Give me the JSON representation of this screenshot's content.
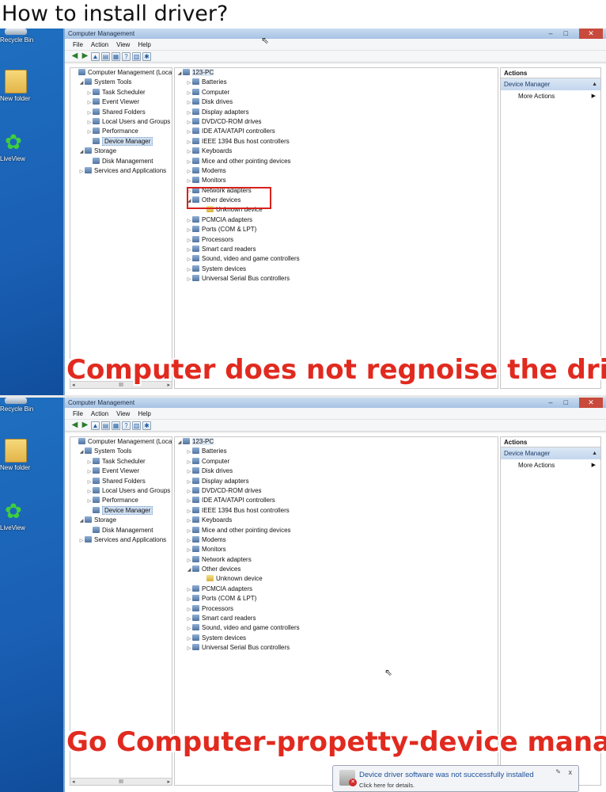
{
  "heading": "How to install driver?",
  "desktop": {
    "icons": [
      {
        "label": "Recycle Bin",
        "icon": "recycle-bin-icon"
      },
      {
        "label": "New folder",
        "icon": "folder-icon"
      },
      {
        "label": "LiveView",
        "icon": "liveview-icon"
      }
    ]
  },
  "window": {
    "title": "Computer Management",
    "menu": [
      "File",
      "Action",
      "View",
      "Help"
    ],
    "left_tree": [
      {
        "label": "Computer Management (Local",
        "level": 0,
        "exp": "",
        "icon": "computer-management-icon"
      },
      {
        "label": "System Tools",
        "level": 1,
        "exp": "◢",
        "icon": "tools-icon"
      },
      {
        "label": "Task Scheduler",
        "level": 2,
        "exp": "▷",
        "icon": "clock-icon"
      },
      {
        "label": "Event Viewer",
        "level": 2,
        "exp": "▷",
        "icon": "event-viewer-icon"
      },
      {
        "label": "Shared Folders",
        "level": 2,
        "exp": "▷",
        "icon": "shared-folder-icon"
      },
      {
        "label": "Local Users and Groups",
        "level": 2,
        "exp": "▷",
        "icon": "users-icon"
      },
      {
        "label": "Performance",
        "level": 2,
        "exp": "▷",
        "icon": "performance-icon"
      },
      {
        "label": "Device Manager",
        "level": 2,
        "exp": "",
        "icon": "device-manager-icon",
        "selected": true
      },
      {
        "label": "Storage",
        "level": 1,
        "exp": "◢",
        "icon": "storage-icon"
      },
      {
        "label": "Disk Management",
        "level": 2,
        "exp": "",
        "icon": "disk-management-icon"
      },
      {
        "label": "Services and Applications",
        "level": 1,
        "exp": "▷",
        "icon": "services-icon"
      }
    ],
    "scroll_mid": "III",
    "device_root": "123-PC",
    "devices": [
      {
        "label": "Batteries",
        "level": 1,
        "exp": "▷",
        "icon": "battery-icon"
      },
      {
        "label": "Computer",
        "level": 1,
        "exp": "▷",
        "icon": "computer-icon"
      },
      {
        "label": "Disk drives",
        "level": 1,
        "exp": "▷",
        "icon": "disk-drive-icon"
      },
      {
        "label": "Display adapters",
        "level": 1,
        "exp": "▷",
        "icon": "display-adapter-icon"
      },
      {
        "label": "DVD/CD-ROM drives",
        "level": 1,
        "exp": "▷",
        "icon": "dvd-icon"
      },
      {
        "label": "IDE ATA/ATAPI controllers",
        "level": 1,
        "exp": "▷",
        "icon": "ide-controller-icon"
      },
      {
        "label": "IEEE 1394 Bus host controllers",
        "level": 1,
        "exp": "▷",
        "icon": "ieee1394-icon"
      },
      {
        "label": "Keyboards",
        "level": 1,
        "exp": "▷",
        "icon": "keyboard-icon"
      },
      {
        "label": "Mice and other pointing devices",
        "level": 1,
        "exp": "▷",
        "icon": "mouse-icon"
      },
      {
        "label": "Modems",
        "level": 1,
        "exp": "▷",
        "icon": "modem-icon"
      },
      {
        "label": "Monitors",
        "level": 1,
        "exp": "▷",
        "icon": "monitor-icon"
      },
      {
        "label": "Network adapters",
        "level": 1,
        "exp": "▷",
        "icon": "network-adapter-icon"
      },
      {
        "label": "Other devices",
        "level": 1,
        "exp": "◢",
        "icon": "other-devices-icon"
      },
      {
        "label": "Unknown device",
        "level": 2,
        "exp": "",
        "icon": "warning-device-icon"
      },
      {
        "label": "PCMCIA adapters",
        "level": 1,
        "exp": "▷",
        "icon": "pcmcia-icon"
      },
      {
        "label": "Ports (COM & LPT)",
        "level": 1,
        "exp": "▷",
        "icon": "port-icon"
      },
      {
        "label": "Processors",
        "level": 1,
        "exp": "▷",
        "icon": "processor-icon"
      },
      {
        "label": "Smart card readers",
        "level": 1,
        "exp": "▷",
        "icon": "smart-card-icon"
      },
      {
        "label": "Sound, video and game controllers",
        "level": 1,
        "exp": "▷",
        "icon": "sound-icon"
      },
      {
        "label": "System devices",
        "level": 1,
        "exp": "▷",
        "icon": "system-devices-icon"
      },
      {
        "label": "Universal Serial Bus controllers",
        "level": 1,
        "exp": "▷",
        "icon": "usb-icon"
      }
    ],
    "actions": {
      "header": "Actions",
      "selected": "Device Manager",
      "more": "More Actions"
    }
  },
  "captions": {
    "top": "Computer does not regnoise the driver",
    "bottom": "Go Computer-propetty-device manager"
  },
  "notification": {
    "title": "Device driver software was not successfully installed",
    "subtitle": "Click here for details.",
    "close": "x"
  },
  "colors": {
    "caption_red": "#e12a1f",
    "highlight_red": "#d8211c",
    "desktop_blue": "#1a5fb4"
  }
}
